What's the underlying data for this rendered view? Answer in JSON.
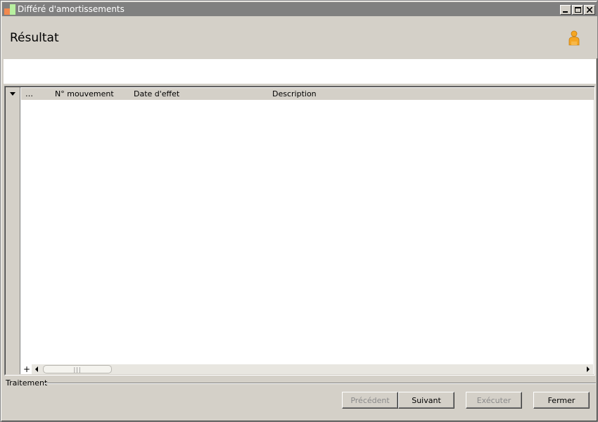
{
  "window": {
    "title": "Différé d'amortissements"
  },
  "header": {
    "title": "Résultat",
    "icon": "person-icon"
  },
  "grid": {
    "selector_glyph": "…",
    "columns": [
      "N° mouvement",
      "Date d'effet",
      "Description"
    ],
    "add_row_label": "+",
    "scroll_thumb_grip": "|||",
    "rows": []
  },
  "group": {
    "label": "Traitement"
  },
  "buttons": {
    "previous": "Précédent",
    "next": "Suivant",
    "execute": "Exécuter",
    "close": "Fermer"
  },
  "colors": {
    "face": "#d4d0c8",
    "titlebar": "#808080",
    "person_icon": "#f5a623"
  }
}
